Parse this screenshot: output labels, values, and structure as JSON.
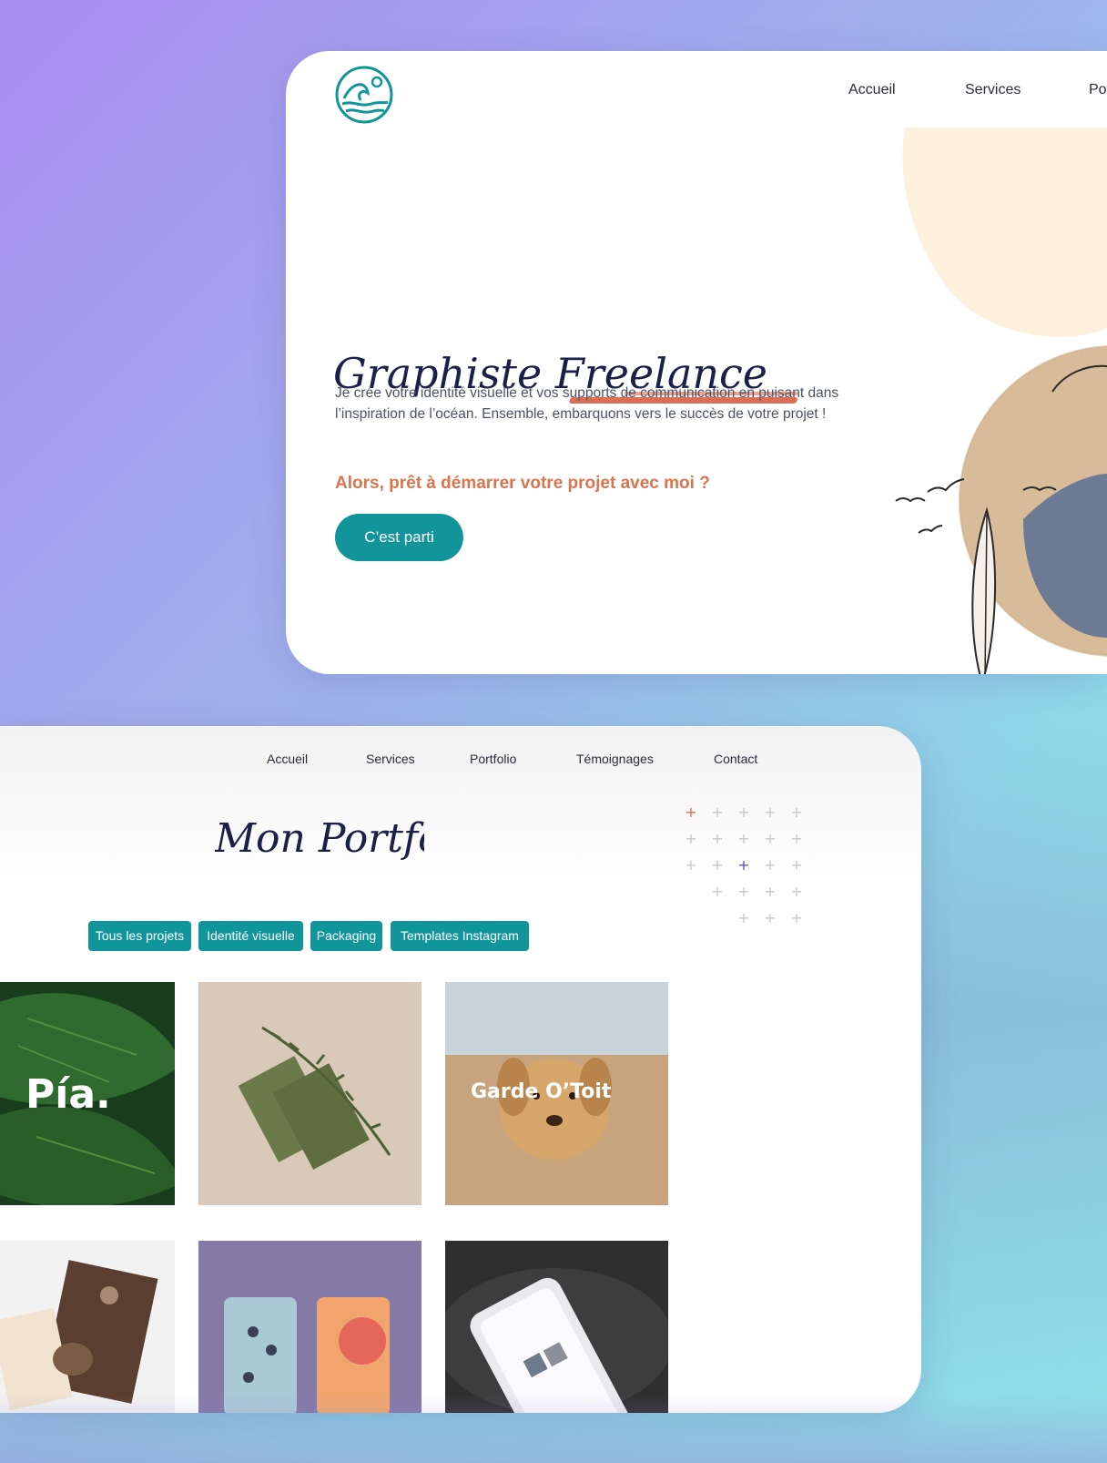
{
  "top_site": {
    "nav": [
      "Accueil",
      "Services",
      "Po"
    ],
    "hero": {
      "title": "Graphiste Freelance",
      "text": "Je crée votre identité visuelle et vos supports de communication en puisant dans l’inspiration de l’océan. Ensemble, embarquons vers le succès de votre projet !",
      "question": "Alors, prêt à démarrer votre projet avec moi ?",
      "button": "C’est parti"
    },
    "colors": {
      "accent": "#11959b",
      "highlight": "#d9744f",
      "title": "#1c1f48",
      "sand": "#fdf0dc"
    },
    "logo_icon": "wave-icon"
  },
  "bottom_site": {
    "nav": [
      "Accueil",
      "Services",
      "Portfolio",
      "Témoignages",
      "Contact"
    ],
    "title": "Mon Portfolio",
    "filters": [
      "Tous les projets",
      "Identité visuelle",
      "Packaging",
      "Templates Instagram"
    ],
    "tiles": [
      {
        "label": "Pía."
      },
      {
        "label": ""
      },
      {
        "label": "Garde O’Toit"
      },
      {
        "label": ""
      },
      {
        "label": ""
      },
      {
        "label": ""
      }
    ]
  }
}
